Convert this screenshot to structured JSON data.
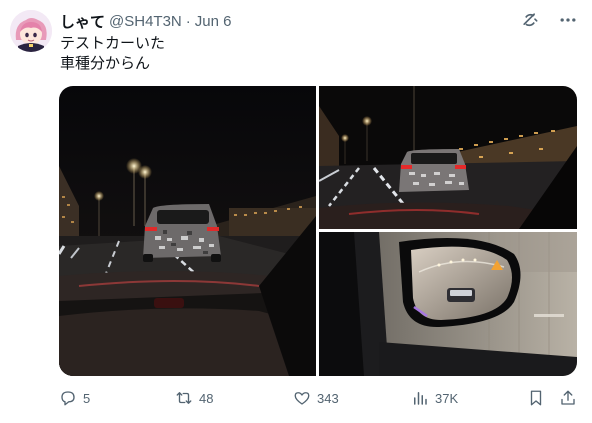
{
  "tweet": {
    "display_name": "しゃて",
    "handle": "@SH4T3N",
    "separator": "·",
    "date": "Jun 6",
    "lines": [
      "テストカーいた",
      "車種分からん"
    ]
  },
  "icons": {
    "grok": "grok-icon",
    "more": "more-icon",
    "reply": "reply-icon",
    "retweet": "retweet-icon",
    "like": "like-icon",
    "views": "views-icon",
    "bookmark": "bookmark-icon",
    "share": "share-icon"
  },
  "stats": {
    "replies": "5",
    "retweets": "48",
    "likes": "343",
    "views": "37K"
  },
  "colors": {
    "text": "#0f1419",
    "secondary": "#536471",
    "accent": "#1d9bf0"
  }
}
